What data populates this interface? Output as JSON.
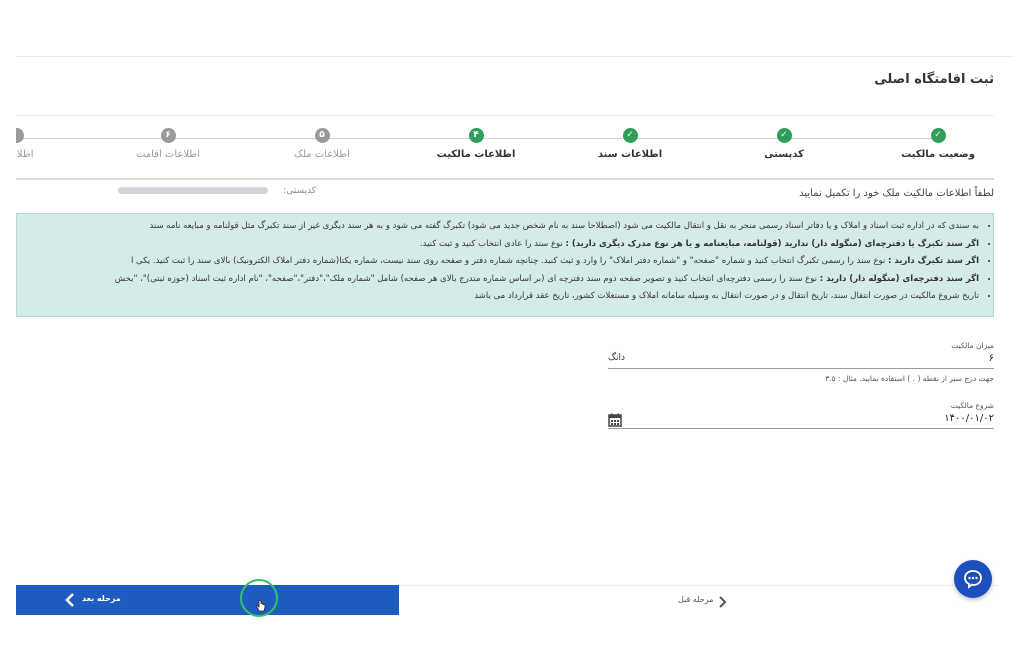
{
  "page_title": "ثبت اقامتگاه اصلی",
  "steps": [
    {
      "label": "وضعیت مالکیت",
      "state": "done",
      "icon": "check-icon"
    },
    {
      "label": "کدپستی",
      "state": "done",
      "icon": "check-icon"
    },
    {
      "label": "اطلاعات سند",
      "state": "done",
      "icon": "check-icon"
    },
    {
      "label": "اطلاعات مالکیت",
      "state": "active",
      "number": "۴"
    },
    {
      "label": "اطلاعات ملک",
      "state": "pending",
      "number": "۵"
    },
    {
      "label": "اطلاعات اقامت",
      "state": "pending",
      "number": "۶"
    },
    {
      "label": "اطلاعات",
      "state": "pending",
      "number": ""
    }
  ],
  "instruction": "لطفاً اطلاعات مالکیت ملک خود را تکمیل نمایید",
  "postal_code_label": "کدپستی:",
  "info": {
    "line1": "به سندی که در اداره ثبت اسناد و املاک و یا دفاتر اسناد رسمی منجر به نقل و انتقال مالکیت می شود (اصطلاحا سند به نام شخص جدید می شود) تکبرگ گفته می شود و به هر سند دیگری غیر از سند تکبرگ مثل قولنامه و مبایعه نامه سند",
    "line2_bold": "اگر سند تکبرگ یا دفترچه‌ای (منگوله دار) ندارید (قولنامه، مبایعنامه و یا هر نوع مدرک دیگری دارید) :",
    "line2_rest": " نوع سند را عادی انتخاب کنید و ثبت کنید.",
    "line3_bold": "اگر سند تکبرگ دارید :",
    "line3_rest": " نوع سند را رسمی تکبرگ انتخاب کنید و شماره \"صفحه\" و \"شماره دفتر املاک\" را وارد و ثبت کنید. چنانچه شماره دفتر و صفحه روی سند نیست، شماره یکتا(شماره دفتر املاک الکترونیک) بالای سند را ثبت کنید. یکی ا",
    "line4_bold": "اگر سند دفترچه‌ای (منگوله دار) دارید :",
    "line4_rest": " نوع سند را رسمی دفترچه‌ای انتخاب کنید و تصویر صفحه دوم سند دفترچه ای (بر اساس شماره مندرج بالای هر صفحه) شامل \"شماره ملک\"،\"دفتر\"،\"صفحه\"، \"نام اداره ثبت اسناد (حوزه ثبتی)\"، \"بخش",
    "line5": "تاریخ شروع مالکیت در صورت انتقال سند، تاریخ انتقال و در صورت انتقال به وسیله سامانه املاک و مستغلات کشور، تاریخ عقد قرارداد می باشد"
  },
  "ownership_amount": {
    "label": "میزان مالکیت",
    "value": "۶",
    "unit": "دانگ",
    "hint": "جهت درج سیر از نقطه ( . ) استفاده نمایید. مثال : ۳.۵"
  },
  "ownership_start": {
    "label": "شروع مالکیت",
    "value": "۱۴۰۰/۰۱/۰۲"
  },
  "buttons": {
    "prev": "مرحله قبل",
    "next": "مرحله بعد"
  },
  "colors": {
    "primary": "#1f5cbf",
    "success": "#2e9e5a",
    "info_bg": "#d5ebe7"
  }
}
